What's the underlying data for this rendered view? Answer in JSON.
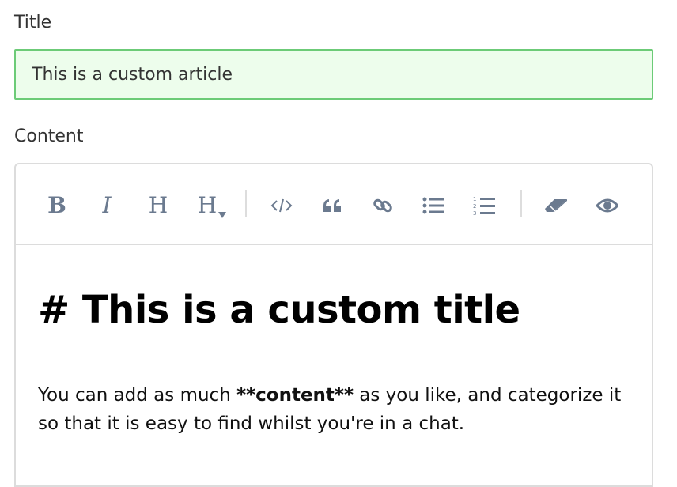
{
  "form": {
    "title_label": "Title",
    "title_value": "This is a custom article",
    "content_label": "Content"
  },
  "toolbar": {
    "buttons": [
      {
        "icon": "bold-icon",
        "glyph": "B"
      },
      {
        "icon": "italic-icon",
        "glyph": "I"
      },
      {
        "icon": "heading-icon",
        "glyph": "H"
      },
      {
        "icon": "heading-dropdown-icon",
        "glyph": "H"
      },
      {
        "icon": "code-icon",
        "glyph": "</>"
      },
      {
        "icon": "quote-icon"
      },
      {
        "icon": "link-icon"
      },
      {
        "icon": "bulleted-list-icon"
      },
      {
        "icon": "numbered-list-icon"
      },
      {
        "icon": "eraser-icon"
      },
      {
        "icon": "preview-eye-icon"
      }
    ],
    "icon_color": "#6b7a8f"
  },
  "content": {
    "heading": "# This is a custom title",
    "paragraph_before": "You can add as much ",
    "paragraph_bold": "**content**",
    "paragraph_after": " as you like, and categorize it so that it is easy to find whilst you're in a chat."
  },
  "colors": {
    "input_bg": "#edfdec",
    "input_border": "#6ccb77",
    "editor_border": "#dcdcdc"
  }
}
